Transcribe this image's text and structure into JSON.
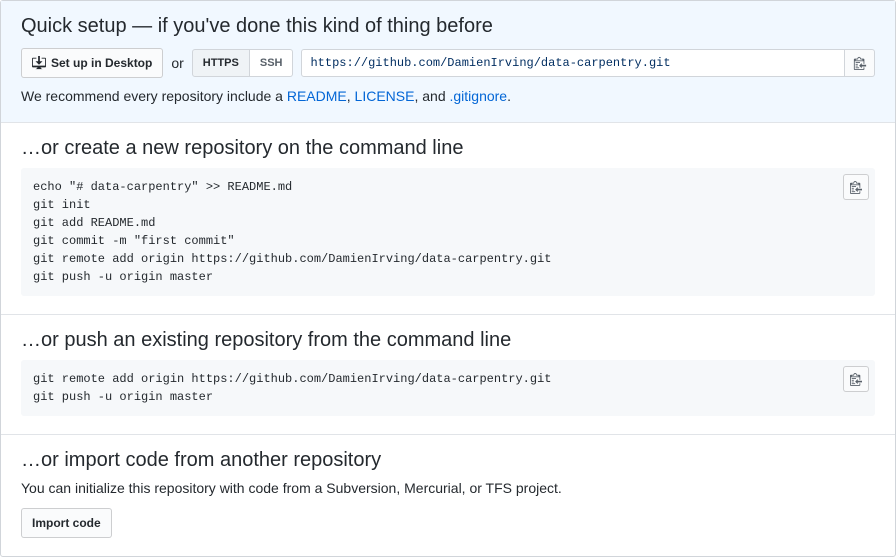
{
  "quick": {
    "title": "Quick setup — if you've done this kind of thing before",
    "setup_desktop": "Set up in Desktop",
    "or": "or",
    "tab_https": "HTTPS",
    "tab_ssh": "SSH",
    "clone_url": "https://github.com/DamienIrving/data-carpentry.git",
    "rec_prefix": "We recommend every repository include a ",
    "rec_readme": "README",
    "rec_sep1": ", ",
    "rec_license": "LICENSE",
    "rec_sep2": ", and ",
    "rec_gitignore": ".gitignore",
    "rec_suffix": "."
  },
  "create": {
    "title": "…or create a new repository on the command line",
    "code": "echo \"# data-carpentry\" >> README.md\ngit init\ngit add README.md\ngit commit -m \"first commit\"\ngit remote add origin https://github.com/DamienIrving/data-carpentry.git\ngit push -u origin master"
  },
  "push": {
    "title": "…or push an existing repository from the command line",
    "code": "git remote add origin https://github.com/DamienIrving/data-carpentry.git\ngit push -u origin master"
  },
  "import": {
    "title": "…or import code from another repository",
    "desc": "You can initialize this repository with code from a Subversion, Mercurial, or TFS project.",
    "button": "Import code"
  }
}
